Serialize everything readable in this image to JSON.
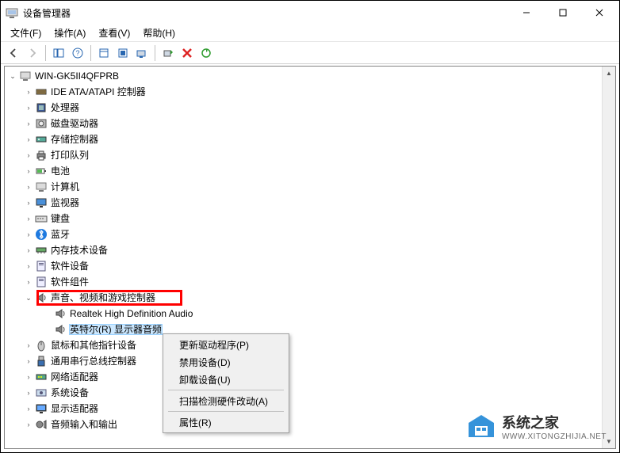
{
  "window": {
    "title": "设备管理器",
    "buttons": {
      "minimize": "–",
      "maximize": "□",
      "close": "×"
    }
  },
  "menu": {
    "file": "文件(F)",
    "action": "操作(A)",
    "view": "查看(V)",
    "help": "帮助(H)"
  },
  "root": {
    "label": "WIN-GK5II4QFPRB"
  },
  "categories": [
    {
      "id": "ide",
      "label": "IDE ATA/ATAPI 控制器"
    },
    {
      "id": "cpu",
      "label": "处理器"
    },
    {
      "id": "diskdrive",
      "label": "磁盘驱动器"
    },
    {
      "id": "storage",
      "label": "存储控制器"
    },
    {
      "id": "printq",
      "label": "打印队列"
    },
    {
      "id": "battery",
      "label": "电池"
    },
    {
      "id": "computer",
      "label": "计算机"
    },
    {
      "id": "monitor",
      "label": "监视器"
    },
    {
      "id": "keyboard",
      "label": "键盘"
    },
    {
      "id": "bluetooth",
      "label": "蓝牙"
    },
    {
      "id": "ram",
      "label": "内存技术设备"
    },
    {
      "id": "swdev",
      "label": "软件设备"
    },
    {
      "id": "swcomp",
      "label": "软件组件"
    }
  ],
  "sound": {
    "label": "声音、视频和游戏控制器",
    "children": {
      "realtek": "Realtek High Definition Audio",
      "intel": "英特尔(R) 显示器音频"
    }
  },
  "after": [
    {
      "id": "mouse",
      "label": "鼠标和其他指针设备"
    },
    {
      "id": "usb",
      "label": "通用串行总线控制器"
    },
    {
      "id": "network",
      "label": "网络适配器"
    },
    {
      "id": "system",
      "label": "系统设备"
    },
    {
      "id": "display",
      "label": "显示适配器"
    },
    {
      "id": "audioio",
      "label": "音频输入和输出"
    }
  ],
  "context_menu": {
    "update": "更新驱动程序(P)",
    "disable": "禁用设备(D)",
    "uninstall": "卸载设备(U)",
    "scan": "扫描检测硬件改动(A)",
    "properties": "属性(R)"
  },
  "watermark": {
    "cn": "系统之家",
    "url": "WWW.XITONGZHIJIA.NET"
  }
}
